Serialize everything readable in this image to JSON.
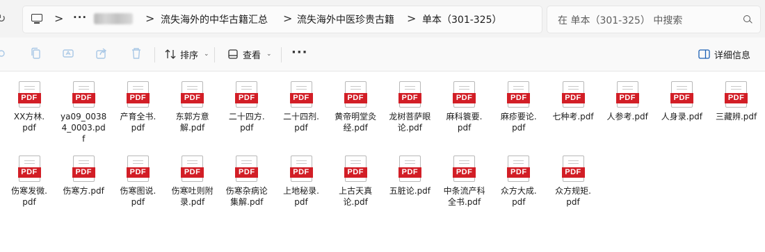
{
  "address_bar": {
    "separator": ">",
    "ellipsis": "···",
    "crumbs": [
      "流失海外的中华古籍汇总",
      "流失海外中医珍贵古籍",
      "单本（301-325）"
    ]
  },
  "search": {
    "placeholder": "在 单本（301-325） 中搜索"
  },
  "command_bar": {
    "sort_label": "排序",
    "view_label": "查看",
    "more_label": "···",
    "details_label": "详细信息"
  },
  "files": [
    {
      "name": "XX方林.\npdf",
      "type": "PDF"
    },
    {
      "name": "ya09_0038\n4_0003.pd\nf",
      "type": "PDF"
    },
    {
      "name": "产育全书.\npdf",
      "type": "PDF"
    },
    {
      "name": "东郭方意\n解.pdf",
      "type": "PDF"
    },
    {
      "name": "二十四方.\npdf",
      "type": "PDF"
    },
    {
      "name": "二十四剂.\npdf",
      "type": "PDF"
    },
    {
      "name": "黄帝明堂灸\n经.pdf",
      "type": "PDF"
    },
    {
      "name": "龙树菩萨眼\n论.pdf",
      "type": "PDF"
    },
    {
      "name": "麻科簑要.\npdf",
      "type": "PDF"
    },
    {
      "name": "麻疹要论.\npdf",
      "type": "PDF"
    },
    {
      "name": "七种考.pdf",
      "type": "PDF"
    },
    {
      "name": "人参考.pdf",
      "type": "PDF"
    },
    {
      "name": "人身录.pdf",
      "type": "PDF"
    },
    {
      "name": "三藏辨.pdf",
      "type": "PDF"
    },
    {
      "name": "伤寒发微.\npdf",
      "type": "PDF"
    },
    {
      "name": "伤寒方.pdf",
      "type": "PDF"
    },
    {
      "name": "伤寒图说.\npdf",
      "type": "PDF"
    },
    {
      "name": "伤寒吐则附\n录.pdf",
      "type": "PDF"
    },
    {
      "name": "伤寒杂病论\n集解.pdf",
      "type": "PDF"
    },
    {
      "name": "上地秘录.\npdf",
      "type": "PDF"
    },
    {
      "name": "上古天真\n论.pdf",
      "type": "PDF"
    },
    {
      "name": "五脏论.pdf",
      "type": "PDF"
    },
    {
      "name": "中条流产科\n全书.pdf",
      "type": "PDF"
    },
    {
      "name": "众方大成.\npdf",
      "type": "PDF"
    },
    {
      "name": "众方规矩.\npdf",
      "type": "PDF"
    }
  ]
}
